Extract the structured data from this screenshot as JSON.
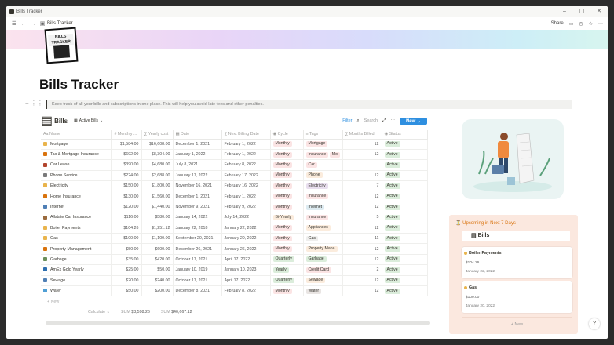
{
  "window": {
    "title": "Bills Tracker",
    "controls": [
      "–",
      "▢",
      "✕"
    ]
  },
  "topbar": {
    "breadcrumb": "Bills Tracker",
    "share": "Share"
  },
  "logo": {
    "text": "BILLS TRACKER"
  },
  "page": {
    "title": "Bills Tracker",
    "description": "Keep track of all your bills and subscriptions in one place. This will help you avoid late fees and other penalties."
  },
  "db": {
    "title": "Bills",
    "view": "Active Bills",
    "filter": "Filter",
    "search": "Search",
    "new": "New"
  },
  "columns": [
    "Name",
    "Monthly ...",
    "Yearly cost",
    "Date",
    "Next Billing Date",
    "Cycle",
    "Tags",
    "Months Billed",
    "Status"
  ],
  "rows": [
    {
      "name": "Mortgage",
      "monthly": "$1,584.00",
      "yearly": "$16,608.00",
      "date": "December 1, 2021",
      "next": "February 1, 2022",
      "cycle": "Monthly",
      "tag": "Mortgage",
      "months": "12",
      "status": "Active"
    },
    {
      "name": "Tax & Mortgage Insurance",
      "monthly": "$692.00",
      "yearly": "$8,304.00",
      "date": "January 1, 2022",
      "next": "February 1, 2022",
      "cycle": "Monthly",
      "tag": "Insurance",
      "tag2": "Mo",
      "months": "12",
      "status": "Active"
    },
    {
      "name": "Car Lease",
      "monthly": "$390.00",
      "yearly": "$4,680.00",
      "date": "July 8, 2021",
      "next": "February 8, 2022",
      "cycle": "Monthly",
      "tag": "Car",
      "months": "",
      "status": "Active"
    },
    {
      "name": "Phone Service",
      "monthly": "$224.00",
      "yearly": "$2,688.00",
      "date": "January 17, 2022",
      "next": "February 17, 2022",
      "cycle": "Monthly",
      "tag": "Phone",
      "months": "12",
      "status": "Active"
    },
    {
      "name": "Electricity",
      "monthly": "$150.00",
      "yearly": "$1,800.00",
      "date": "November 16, 2021",
      "next": "February 16, 2022",
      "cycle": "Monthly",
      "tag": "Electricity",
      "months": "7",
      "status": "Active"
    },
    {
      "name": "Home Insurance",
      "monthly": "$130.00",
      "yearly": "$1,560.00",
      "date": "December 1, 2021",
      "next": "February 1, 2022",
      "cycle": "Monthly",
      "tag": "Insurance",
      "months": "12",
      "status": "Active"
    },
    {
      "name": "Internet",
      "monthly": "$120.00",
      "yearly": "$1,440.00",
      "date": "November 9, 2021",
      "next": "February 9, 2022",
      "cycle": "Monthly",
      "tag": "Internet",
      "months": "12",
      "status": "Active"
    },
    {
      "name": "Allstate Car Insurance",
      "monthly": "$116.00",
      "yearly": "$580.00",
      "date": "January 14, 2022",
      "next": "July 14, 2022",
      "cycle": "Bi-Yearly",
      "tag": "Insurance",
      "months": "5",
      "status": "Active"
    },
    {
      "name": "Boiler Payments",
      "monthly": "$104.26",
      "yearly": "$1,251.12",
      "date": "January 22, 2018",
      "next": "January 22, 2022",
      "cycle": "Monthly",
      "tag": "Appliances",
      "months": "12",
      "status": "Active"
    },
    {
      "name": "Gas",
      "monthly": "$100.00",
      "yearly": "$1,100.00",
      "date": "September 20, 2021",
      "next": "January 20, 2022",
      "cycle": "Monthly",
      "tag": "Gas",
      "months": "11",
      "status": "Active"
    },
    {
      "name": "Property Management",
      "monthly": "$50.00",
      "yearly": "$600.00",
      "date": "December 26, 2021",
      "next": "January 26, 2022",
      "cycle": "Monthly",
      "tag": "Property Mana",
      "months": "12",
      "status": "Active"
    },
    {
      "name": "Garbage",
      "monthly": "$35.00",
      "yearly": "$420.00",
      "date": "October 17, 2021",
      "next": "April 17, 2022",
      "cycle": "Quarterly",
      "tag": "Garbage",
      "months": "12",
      "status": "Active"
    },
    {
      "name": "AmEx Gold Yearly",
      "monthly": "$25.00",
      "yearly": "$50.00",
      "date": "January 10, 2019",
      "next": "January 10, 2023",
      "cycle": "Yearly",
      "tag": "Credit Card",
      "months": "2",
      "status": "Active"
    },
    {
      "name": "Sewage",
      "monthly": "$20.00",
      "yearly": "$240.00",
      "date": "October 17, 2021",
      "next": "April 17, 2022",
      "cycle": "Quarterly",
      "tag": "Sewage",
      "months": "12",
      "status": "Active"
    },
    {
      "name": "Water",
      "monthly": "$50.00",
      "yearly": "$200.00",
      "date": "December 8, 2021",
      "next": "February 8, 2022",
      "cycle": "Monthly",
      "tag": "Water",
      "months": "12",
      "status": "Active"
    }
  ],
  "table_footer": {
    "new": "+ New",
    "calculate": "Calculate ⌄",
    "sum1_label": "SUM",
    "sum1": "$3,598.26",
    "sum2_label": "SUM",
    "sum2": "$40,667.12"
  },
  "upcoming": {
    "title": "Upcoming in Next 7 Days",
    "bills_label": "Bills",
    "new": "+ New",
    "cards": [
      {
        "name": "Boiler Payments",
        "value": "$104.26",
        "date": "January 22, 2022"
      },
      {
        "name": "Gas",
        "value": "$100.00",
        "date": "January 20, 2022"
      }
    ]
  },
  "help": "?",
  "colors": {
    "accent": "#2e8fe0",
    "cycle": "#fbe4e4",
    "status": "#dbeddb",
    "quarterly": "#dbeddb",
    "yearly": "#dbeddb",
    "panel": "#fbe8df"
  }
}
